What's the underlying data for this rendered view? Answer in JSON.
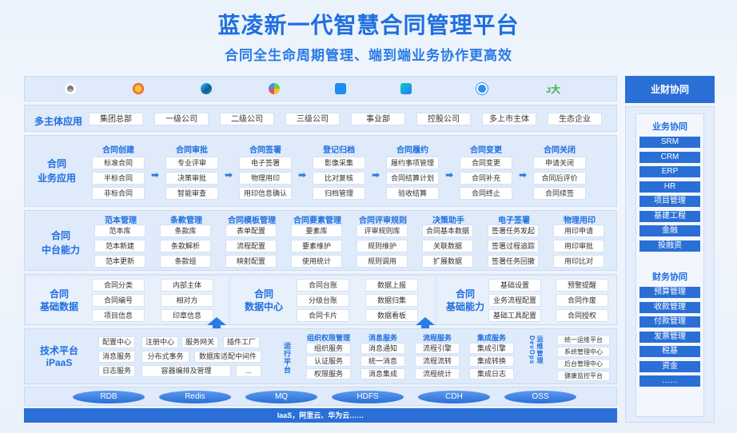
{
  "header": {
    "title": "蓝凌新一代智慧合同管理平台",
    "subtitle": "合同全生命周期管理、端到端业务协作更高效"
  },
  "browsers": [
    "chrome-icon",
    "firefox-icon",
    "edge-icon",
    "360-icon",
    "dingtalk-icon",
    "feishu-icon",
    "wechat-work-icon",
    "kk-icon"
  ],
  "multi_entity": {
    "label": "多主体应用",
    "items": [
      "集团总部",
      "一级公司",
      "二级公司",
      "三级公司",
      "事业部",
      "控股公司",
      "多上市主体",
      "生态企业"
    ]
  },
  "business_app": {
    "label": "合同\n业务应用",
    "stages": [
      {
        "name": "合同创建",
        "items": [
          "标准合同",
          "半标合同",
          "非标合同"
        ]
      },
      {
        "name": "合同审批",
        "items": [
          "专业评审",
          "决策审批",
          "智能审查"
        ]
      },
      {
        "name": "合同签署",
        "items": [
          "电子签署",
          "物理用印",
          "用印信息确认"
        ]
      },
      {
        "name": "登记归档",
        "items": [
          "影像采集",
          "比对复核",
          "归档管理"
        ]
      },
      {
        "name": "合同履约",
        "items": [
          "履约事项管理",
          "合同结算计划",
          "验收结算"
        ]
      },
      {
        "name": "合同变更",
        "items": [
          "合同变更",
          "合同补充",
          "合同终止"
        ]
      },
      {
        "name": "合同关闭",
        "items": [
          "申请关闭",
          "合同后评价",
          "合同续签"
        ]
      }
    ]
  },
  "middle_ability": {
    "label": "合同\n中台能力",
    "groups": [
      {
        "name": "范本管理",
        "items": [
          "范本库",
          "范本新建",
          "范本更新"
        ]
      },
      {
        "name": "条款管理",
        "items": [
          "条款库",
          "条款解析",
          "条款组"
        ]
      },
      {
        "name": "合同模板管理",
        "items": [
          "表单配置",
          "流程配置",
          "映射配置"
        ]
      },
      {
        "name": "合同要素管理",
        "items": [
          "要素库",
          "要素维护",
          "使用统计"
        ]
      },
      {
        "name": "合同评审规则",
        "items": [
          "评审规则库",
          "规则维护",
          "规则调用"
        ]
      },
      {
        "name": "决策助手",
        "items": [
          "合同基本数据",
          "关联数据",
          "扩展数据"
        ]
      },
      {
        "name": "电子签署",
        "items": [
          "签署任务发起",
          "签署过程追踪",
          "签署任务回撤"
        ]
      },
      {
        "name": "物理用印",
        "items": [
          "用印申请",
          "用印审批",
          "用印比对"
        ]
      }
    ]
  },
  "basic_data": {
    "label": "合同\n基础数据",
    "items": [
      "合同分类",
      "内部主体",
      "合同编号",
      "相对方",
      "项目信息",
      "印章信息"
    ]
  },
  "data_center": {
    "label": "合同\n数据中心",
    "items": [
      "合同台账",
      "数据上报",
      "分级台账",
      "数据归集",
      "合同卡片",
      "数据看板"
    ]
  },
  "basic_ability": {
    "label": "合同\n基础能力",
    "items": [
      "基础设置",
      "预警提醒",
      "业务流程配置",
      "合同作废",
      "基础工具配置",
      "合同授权"
    ]
  },
  "tech_platform": {
    "label": "技术平台\niPaaS",
    "items": [
      "配置中心",
      "注册中心",
      "服务网关",
      "插件工厂",
      "消息服务",
      "分布式事务",
      "数据库适配中间件",
      "日志服务",
      "容器编排及管理",
      "..."
    ],
    "runtime_label": "运行平台",
    "runtime_groups": [
      {
        "name": "组织权限管理",
        "items": [
          "组织服务",
          "认证服务",
          "权限服务"
        ]
      },
      {
        "name": "消息服务",
        "items": [
          "消息通知",
          "统一消息",
          "消息集成"
        ]
      },
      {
        "name": "流程服务",
        "items": [
          "流程引擎",
          "流程流转",
          "流程统计"
        ]
      },
      {
        "name": "集成服务",
        "items": [
          "集成引擎",
          "集成转换",
          "集成日志"
        ]
      }
    ],
    "ops_label": "运维管理 DevOps",
    "ops_items": [
      "统一运维平台",
      "系统管理中心",
      "后台管理中心",
      "健康监控平台"
    ]
  },
  "databases": [
    "RDB",
    "Redis",
    "MQ",
    "HDFS",
    "CDH",
    "OSS"
  ],
  "iaas": "IaaS，阿里云、华为云……",
  "side": {
    "title": "业财协同",
    "business_title": "业务协同",
    "business_items": [
      "SRM",
      "CRM",
      "ERP",
      "HR",
      "项目管理",
      "基建工程",
      "金融",
      "投融资"
    ],
    "finance_title": "财务协同",
    "finance_items": [
      "预算管理",
      "收款管理",
      "付款管理",
      "发票管理",
      "税基",
      "资金",
      "……"
    ]
  },
  "colors": {
    "primary": "#1f6fe0",
    "accent": "#2a6fd6",
    "panel": "#dfeafa"
  }
}
